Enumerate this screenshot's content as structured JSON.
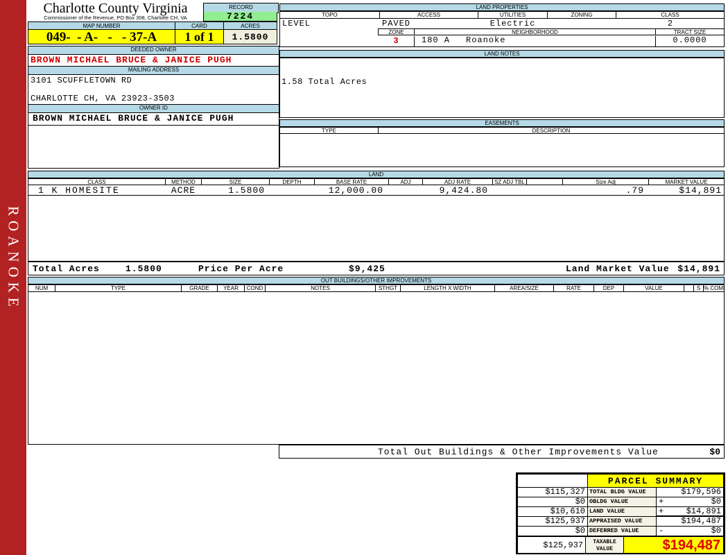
{
  "colors": {
    "blue": "#b5d9e6",
    "yellow": "#ffff00",
    "green": "#90ee90",
    "cream": "#f0efdf",
    "red": "#cc0000",
    "bigred": "#e00000",
    "bar": "#b22222"
  },
  "sidebar": {
    "label": "ROANOKE"
  },
  "header": {
    "county": "Charlotte County Virginia",
    "commissioner": "Commissioner of the Revenue, PO Box 308, Charlotte CH, VA",
    "record_label": "RECORD",
    "record_value": "7224",
    "map_number_label": "MAP NUMBER",
    "map_number": "049-  - A-   -   - 37-A",
    "card_label": "CARD",
    "card_value": "1 of 1",
    "acres_label": "ACRES",
    "acres_value": "1.5800"
  },
  "owner": {
    "deeded_owner_label": "DEEDED OWNER",
    "deeded_owner": "BROWN MICHAEL BRUCE & JANICE PUGH",
    "mailing_address_label": "MAILING ADDRESS",
    "address_line1": "3101 SCUFFLETOWN RD",
    "address_line2": "CHARLOTTE CH, VA 23923-3503",
    "owner_id_label": "OWNER ID",
    "owner_id": "BROWN MICHAEL BRUCE & JANICE PUGH"
  },
  "land_properties": {
    "title": "LAND PROPERTIES",
    "headers": [
      "TOPO",
      "ACCESS",
      "UTILITIES",
      "ZONING",
      "CLASS"
    ],
    "topo": "LEVEL",
    "access": "PAVED",
    "utilities": "Electric",
    "zoning": "",
    "class": "2",
    "zone_label": "ZONE",
    "neighborhood_label": "NEIGHBORHOOD",
    "tract_size_label": "TRACT SIZE",
    "zone": "3",
    "neighborhood_code": "180 A",
    "neighborhood": "Roanoke",
    "tract_size": "0.0000"
  },
  "land_notes": {
    "title": "LAND NOTES",
    "note": "1.58 Total Acres"
  },
  "easements": {
    "title": "EASEMENTS",
    "headers": [
      "TYPE",
      "DESCRIPTION"
    ]
  },
  "land": {
    "title": "LAND",
    "headers": [
      "CLASS",
      "METHOD",
      "SIZE",
      "DEPTH",
      "BASE RATE",
      "ADJ",
      "ADJ RATE",
      "SZ ADJ TBL",
      "",
      "Size Adj",
      "MARKET VALUE"
    ],
    "rows": [
      {
        "class": "1 K HOMESITE",
        "method": "ACRE",
        "size": "1.5800",
        "depth": "",
        "base_rate": "12,000.00",
        "adj": "",
        "adj_rate": "9,424.80",
        "sz_adj_tbl": "",
        "size_adj": ".79",
        "market_value": "$14,891"
      }
    ],
    "totals": {
      "total_acres_label": "Total Acres",
      "total_acres": "1.5800",
      "price_per_acre_label": "Price Per Acre",
      "price_per_acre": "$9,425",
      "land_market_value_label": "Land Market Value",
      "land_market_value": "$14,891"
    }
  },
  "out_buildings": {
    "title": "OUT BUILDINGS/OTHER IMPROVEMENTS",
    "headers": [
      "NUM",
      "TYPE",
      "GRADE",
      "YEAR",
      "COND",
      "NOTES",
      "STHGT",
      "LENGTH X WIDTH",
      "AREA/SIZE",
      "RATE",
      "DEP",
      "VALUE",
      "",
      "S",
      "% COMP"
    ],
    "total_label": "Total Out Buildings & Other Improvements Value",
    "total_value": "$0"
  },
  "parcel_summary": {
    "title": "PARCEL SUMMARY",
    "rows": [
      {
        "prior": "$115,327",
        "label": "TOTAL BLDG VALUE",
        "sign": "",
        "value": "$179,596"
      },
      {
        "prior": "$0",
        "label": "OBLDG VALUE",
        "sign": "+",
        "value": "$0"
      },
      {
        "prior": "$10,610",
        "label": "LAND VALUE",
        "sign": "+",
        "value": "$14,891"
      },
      {
        "prior": "$125,937",
        "label": "APPRAISED VALUE",
        "sign": "",
        "value": "$194,487"
      },
      {
        "prior": "$0",
        "label": "DEFERRED VALUE",
        "sign": "-",
        "value": "$0"
      }
    ],
    "taxable": {
      "prior": "$125,937",
      "label": "TAXABLE VALUE",
      "value": "$194,487"
    }
  }
}
